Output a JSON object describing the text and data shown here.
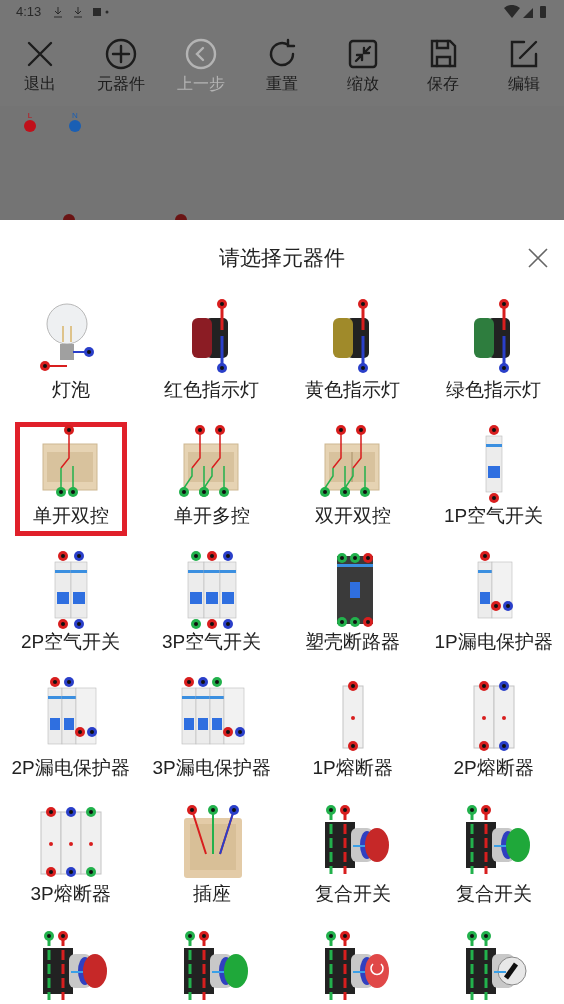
{
  "status_bar": {
    "time": "4:13"
  },
  "toolbar": [
    {
      "kind": "close",
      "label": "退出",
      "disabled": false
    },
    {
      "kind": "add",
      "label": "元器件",
      "disabled": false
    },
    {
      "kind": "back",
      "label": "上一步",
      "disabled": true
    },
    {
      "kind": "reset",
      "label": "重置",
      "disabled": false
    },
    {
      "kind": "zoom",
      "label": "缩放",
      "disabled": false
    },
    {
      "kind": "save",
      "label": "保存",
      "disabled": false
    },
    {
      "kind": "edit",
      "label": "编辑",
      "disabled": false
    }
  ],
  "canvas": {
    "terminals": [
      {
        "label": "L",
        "color": "#c0101a"
      },
      {
        "label": "N",
        "color": "#1a5fb4"
      }
    ]
  },
  "sheet": {
    "title": "请选择元器件",
    "items": [
      {
        "kind": "bulb",
        "label": "灯泡",
        "selected": false
      },
      {
        "kind": "indicator",
        "color": "#8b1c24",
        "label": "红色指示灯",
        "selected": false
      },
      {
        "kind": "indicator",
        "color": "#a08a2a",
        "label": "黄色指示灯",
        "selected": false
      },
      {
        "kind": "indicator",
        "color": "#2e7d3e",
        "label": "绿色指示灯",
        "selected": false
      },
      {
        "kind": "switch1",
        "label": "单开双控",
        "selected": true
      },
      {
        "kind": "switchmulti",
        "label": "单开多控",
        "selected": false
      },
      {
        "kind": "switch2",
        "label": "双开双控",
        "selected": false
      },
      {
        "kind": "mcb1",
        "label": "1P空气开关",
        "selected": false
      },
      {
        "kind": "mcb2",
        "label": "2P空气开关",
        "selected": false
      },
      {
        "kind": "mcb3",
        "label": "3P空气开关",
        "selected": false
      },
      {
        "kind": "mccb",
        "label": "塑壳断路器",
        "selected": false
      },
      {
        "kind": "rcd1",
        "label": "1P漏电保护器",
        "selected": false
      },
      {
        "kind": "rcd2",
        "label": "2P漏电保护器",
        "selected": false
      },
      {
        "kind": "rcd3",
        "label": "3P漏电保护器",
        "selected": false
      },
      {
        "kind": "fuse1",
        "label": "1P熔断器",
        "selected": false
      },
      {
        "kind": "fuse2",
        "label": "2P熔断器",
        "selected": false
      },
      {
        "kind": "fuse3",
        "label": "3P熔断器",
        "selected": false
      },
      {
        "kind": "socket",
        "label": "插座",
        "selected": false
      },
      {
        "kind": "button",
        "color": "#c62828",
        "label": "复合开关",
        "selected": false
      },
      {
        "kind": "button",
        "color": "#1fa83a",
        "label": "复合开关",
        "selected": false
      },
      {
        "kind": "button",
        "color": "#c62828",
        "selected": false
      },
      {
        "kind": "button",
        "color": "#1fa83a",
        "selected": false
      },
      {
        "kind": "estop",
        "color": "#e04848",
        "selected": false
      },
      {
        "kind": "selector",
        "selected": false
      }
    ]
  }
}
